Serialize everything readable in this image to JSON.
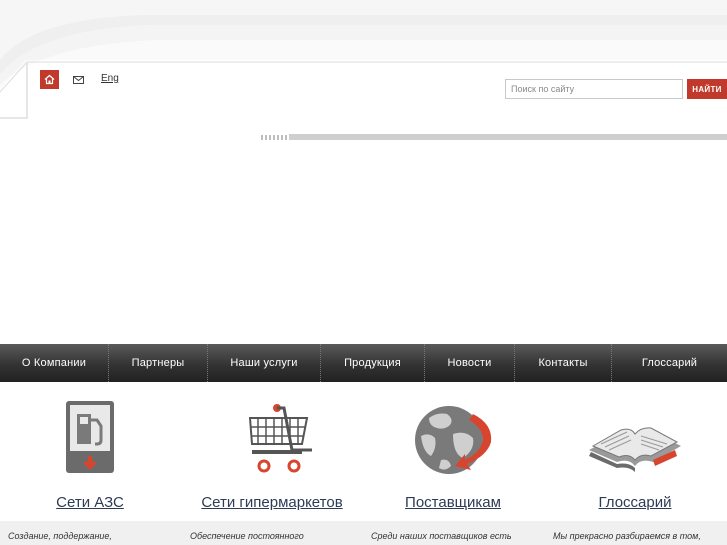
{
  "utility": {
    "lang_label": "Eng"
  },
  "search": {
    "placeholder": "Поиск по сайту",
    "button_label": "НАЙТИ"
  },
  "nav": {
    "items": [
      {
        "label": "О Компании"
      },
      {
        "label": "Партнеры"
      },
      {
        "label": "Наши услуги"
      },
      {
        "label": "Продукция"
      },
      {
        "label": "Новости"
      },
      {
        "label": "Контакты"
      },
      {
        "label": "Глоссарий"
      }
    ]
  },
  "cards": [
    {
      "title": "Сети АЗС",
      "desc": "Создание, поддержание,",
      "icon": "gas-station-icon"
    },
    {
      "title": "Сети гипермаркетов",
      "desc": "Обеспечение постоянного",
      "icon": "shopping-cart-icon"
    },
    {
      "title": "Поставщикам",
      "desc": "Среди наших поставщиков есть",
      "icon": "globe-icon"
    },
    {
      "title": "Глоссарий",
      "desc": "Мы прекрасно разбираемся в том,",
      "icon": "open-book-icon"
    }
  ],
  "colors": {
    "accent": "#c0392b",
    "nav_bg": "#333333",
    "link": "#2e3b55"
  }
}
